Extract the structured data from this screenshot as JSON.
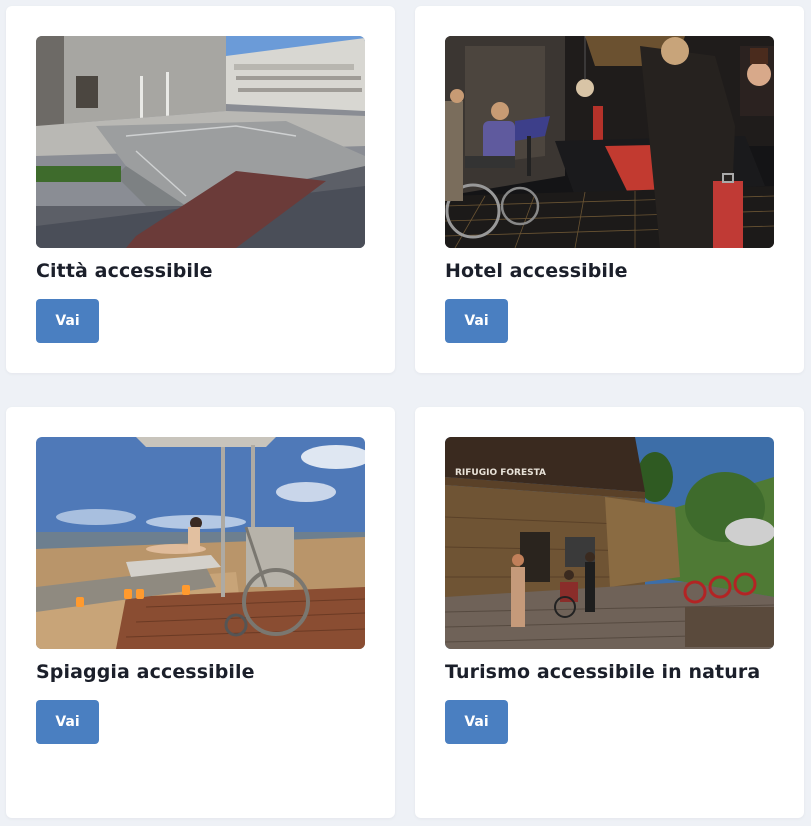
{
  "accent_color": "#4a7fc1",
  "cards": [
    {
      "title": "Città accessibile",
      "button_label": "Vai",
      "image": "accessible-city-render"
    },
    {
      "title": "Hotel accessibile",
      "button_label": "Vai",
      "image": "accessible-hotel-render"
    },
    {
      "title": "Spiaggia accessibile",
      "button_label": "Vai",
      "image": "accessible-beach-render"
    },
    {
      "title": "Turismo accessibile in natura",
      "button_label": "Vai",
      "image": "accessible-nature-lodge-render",
      "sign_text": "RIFUGIO FORESTA"
    }
  ]
}
